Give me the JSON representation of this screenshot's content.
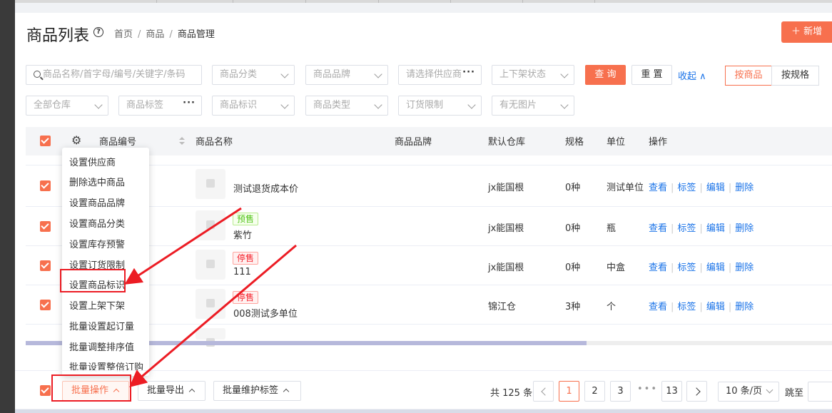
{
  "page": {
    "title": "商品列表",
    "breadcrumb": [
      "首页",
      "商品",
      "商品管理"
    ],
    "add_button": "＋ 新增"
  },
  "filters": {
    "search_placeholder": "商品名称/首字母/编号/关键字/条码",
    "category": "商品分类",
    "brand": "商品品牌",
    "supplier": "请选择供应商",
    "shelf_status": "上下架状态",
    "query": "查 询",
    "reset": "重 置",
    "collapse": "收起",
    "view_by_product": "按商品",
    "view_by_spec": "按规格",
    "warehouse": "全部仓库",
    "product_tag": "商品标签",
    "product_mark": "商品标识",
    "product_type": "商品类型",
    "order_limit": "订货限制",
    "has_image": "有无图片"
  },
  "table": {
    "headers": {
      "code": "商品编号",
      "name": "商品名称",
      "brand": "商品品牌",
      "warehouse": "默认仓库",
      "spec": "规格",
      "unit": "单位",
      "action": "操作"
    },
    "rows": [
      {
        "name": "测试退货成本价",
        "tag": "",
        "warehouse": "jx能国根",
        "spec": "0种",
        "unit": "测试单位"
      },
      {
        "name": "紫竹",
        "tag": "预售",
        "warehouse": "jx能国根",
        "spec": "0种",
        "unit": "瓶"
      },
      {
        "name": "111",
        "tag": "停售",
        "warehouse": "jx能国根",
        "spec": "0种",
        "unit": "中盒"
      },
      {
        "name": "008测试多单位",
        "tag": "停售",
        "warehouse": "锦江仓",
        "spec": "3种",
        "unit": "个"
      }
    ],
    "actions": {
      "view": "查看",
      "tag": "标签",
      "edit": "编辑",
      "delete": "删除"
    }
  },
  "batch_menu": {
    "items": [
      "设置供应商",
      "删除选中商品",
      "设置商品品牌",
      "设置商品分类",
      "设置库存预警",
      "设置订货限制",
      "设置商品标识",
      "设置上架下架",
      "批量设置起订量",
      "批量调整排序值",
      "批量设置整倍订购"
    ]
  },
  "footer": {
    "batch_ops": "批量操作",
    "batch_export": "批量导出",
    "batch_tags": "批量维护标签",
    "total": "共 125 条",
    "pages": [
      "1",
      "2",
      "3",
      "13"
    ],
    "current_page": "1",
    "page_size": "10 条/页",
    "goto": "跳至"
  },
  "colors": {
    "accent": "#f7704e",
    "link": "#1a73e8",
    "annotation": "#ec1c24"
  }
}
